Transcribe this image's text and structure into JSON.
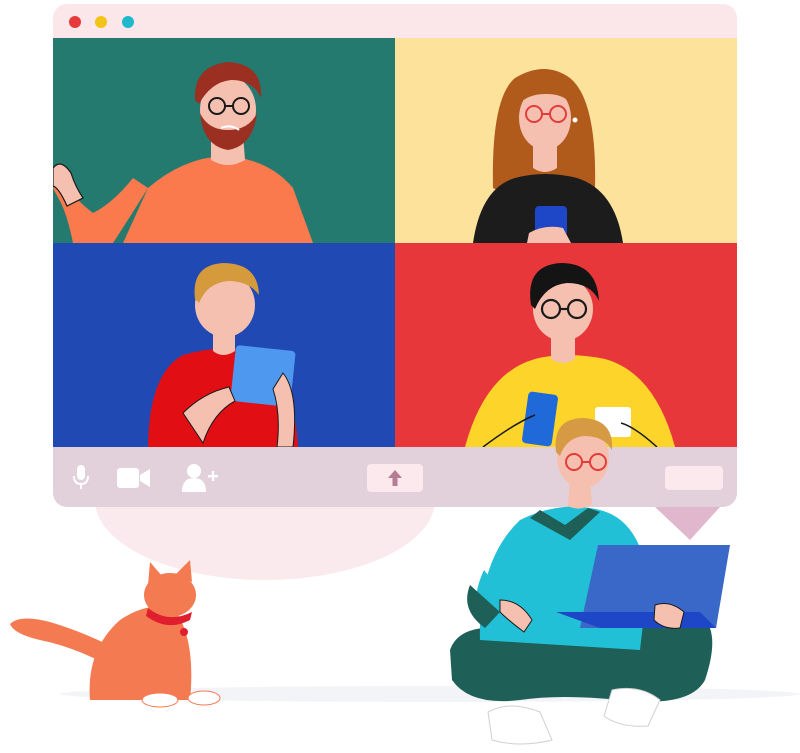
{
  "window": {
    "controls": [
      {
        "name": "close",
        "color": "#e63a3a"
      },
      {
        "name": "minimize",
        "color": "#f2c418"
      },
      {
        "name": "maximize",
        "color": "#1db8c9"
      }
    ]
  },
  "participants": [
    {
      "tile": "top-left",
      "background": "#247a6e",
      "depicts": "bearded-man-waving"
    },
    {
      "tile": "top-right",
      "background": "#fde29c",
      "depicts": "woman-with-phone"
    },
    {
      "tile": "bottom-left",
      "background": "#2149b3",
      "depicts": "man-with-tablet"
    },
    {
      "tile": "bottom-right",
      "background": "#e8373a",
      "depicts": "man-with-phone-and-cup"
    }
  ],
  "toolbar": {
    "buttons": [
      {
        "name": "microphone",
        "icon": "microphone-icon"
      },
      {
        "name": "camera",
        "icon": "video-camera-icon"
      },
      {
        "name": "add-participant",
        "icon": "add-user-icon"
      },
      {
        "name": "share-screen",
        "icon": "upload-arrow-icon"
      },
      {
        "name": "leave",
        "icon": "blank-button"
      }
    ]
  },
  "colors": {
    "frame": "#fbe6ea",
    "toolbar": "#e2d0da",
    "icon": "#ffffff",
    "cat": "#f47a52",
    "laptop": "#3a68c8"
  }
}
